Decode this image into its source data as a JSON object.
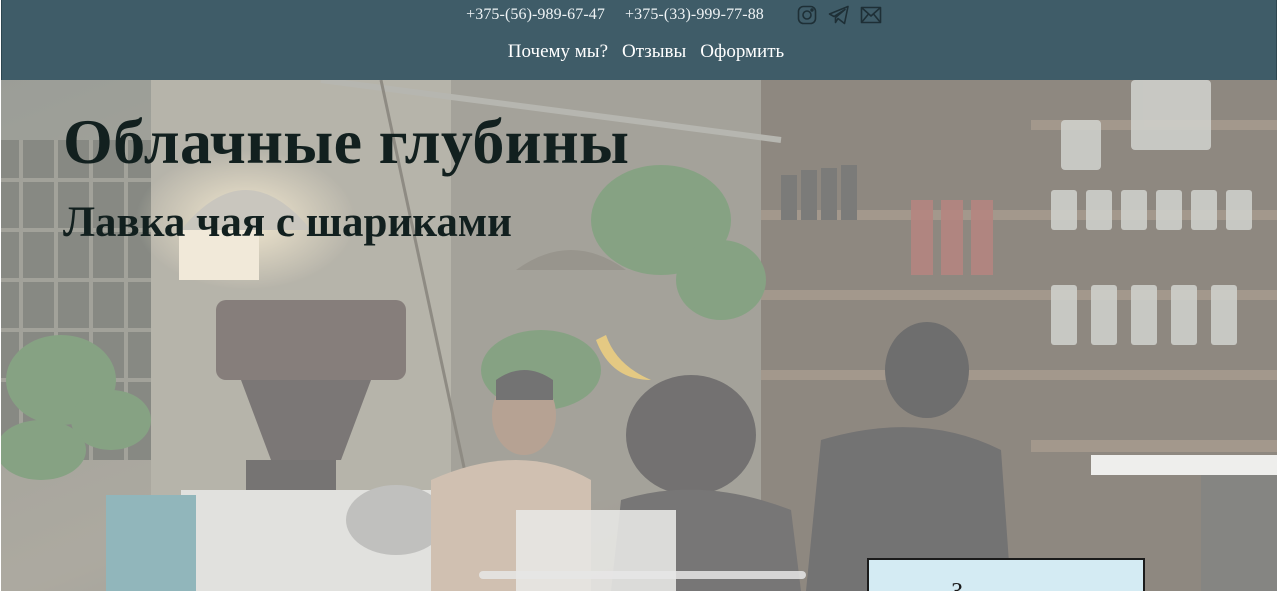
{
  "header": {
    "phones": [
      "+375-(56)-989-67-47",
      "+375-(33)-999-77-88"
    ],
    "social_icons": [
      "instagram-icon",
      "telegram-icon",
      "mail-icon"
    ],
    "nav": [
      {
        "label": "Почему мы?"
      },
      {
        "label": "Отзывы"
      },
      {
        "label": "Оформить"
      }
    ],
    "background_color": "#3f5c68"
  },
  "hero": {
    "title": "Облачные глубины",
    "subtitle": "Лавка чая с шариками",
    "background": "cafe-interior-photo",
    "card_label": "З"
  },
  "colors": {
    "header": "#3f5c68",
    "title_text": "#12201f",
    "card_bg": "#d4ebf3"
  }
}
